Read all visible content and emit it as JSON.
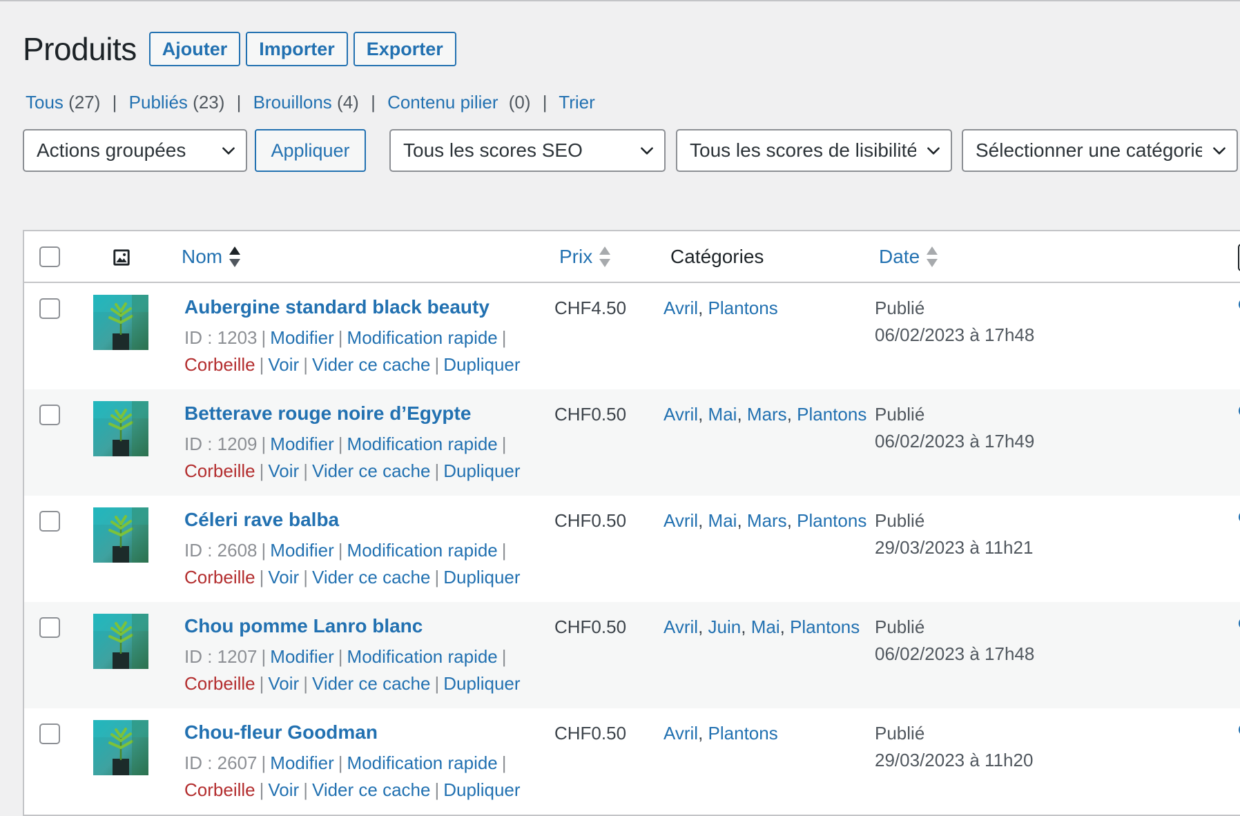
{
  "header": {
    "title": "Produits",
    "buttons": [
      "Ajouter",
      "Importer",
      "Exporter"
    ]
  },
  "filters": {
    "views": [
      {
        "label": "Tous",
        "count": "(27)"
      },
      {
        "label": "Publiés",
        "count": "(23)"
      },
      {
        "label": "Brouillons",
        "count": "(4)"
      },
      {
        "label": "Contenu pilier",
        "count": "(0)"
      },
      {
        "label": "Trier",
        "count": ""
      }
    ],
    "bulk_actions": "Actions groupées",
    "apply": "Appliquer",
    "seo_scores": "Tous les scores SEO",
    "readability_scores": "Tous les scores de lisibilité",
    "category": "Sélectionner une catégorie"
  },
  "table": {
    "columns": {
      "name": "Nom",
      "price": "Prix",
      "categories": "Catégories",
      "date": "Date"
    },
    "row_actions": {
      "edit": "Modifier",
      "quick_edit": "Modification rapide",
      "trash": "Corbeille",
      "view": "Voir",
      "clear_cache": "Vider ce cache",
      "duplicate": "Dupliquer"
    },
    "rows": [
      {
        "name": "Aubergine standard black beauty",
        "id": "ID : 1203",
        "price": "CHF4.50",
        "categories": [
          "Avril",
          "Plantons"
        ],
        "status": "Publié",
        "date": "06/02/2023 à 17h48"
      },
      {
        "name": "Betterave rouge noire d’Egypte",
        "id": "ID : 1209",
        "price": "CHF0.50",
        "categories": [
          "Avril",
          "Mai",
          "Mars",
          "Plantons"
        ],
        "status": "Publié",
        "date": "06/02/2023 à 17h49"
      },
      {
        "name": "Céleri rave balba",
        "id": "ID : 2608",
        "price": "CHF0.50",
        "categories": [
          "Avril",
          "Mai",
          "Mars",
          "Plantons"
        ],
        "status": "Publié",
        "date": "29/03/2023 à 11h21"
      },
      {
        "name": "Chou pomme Lanro blanc",
        "id": "ID : 1207",
        "price": "CHF0.50",
        "categories": [
          "Avril",
          "Juin",
          "Mai",
          "Plantons"
        ],
        "status": "Publié",
        "date": "06/02/2023 à 17h48"
      },
      {
        "name": "Chou-fleur Goodman",
        "id": "ID : 2607",
        "price": "CHF0.50",
        "categories": [
          "Avril",
          "Plantons"
        ],
        "status": "Publié",
        "date": "29/03/2023 à 11h20"
      }
    ]
  },
  "colors": {
    "link": "#2271b1",
    "trash": "#b32d2e",
    "row_alt": "#f6f7f7",
    "background": "#f0f0f1"
  }
}
